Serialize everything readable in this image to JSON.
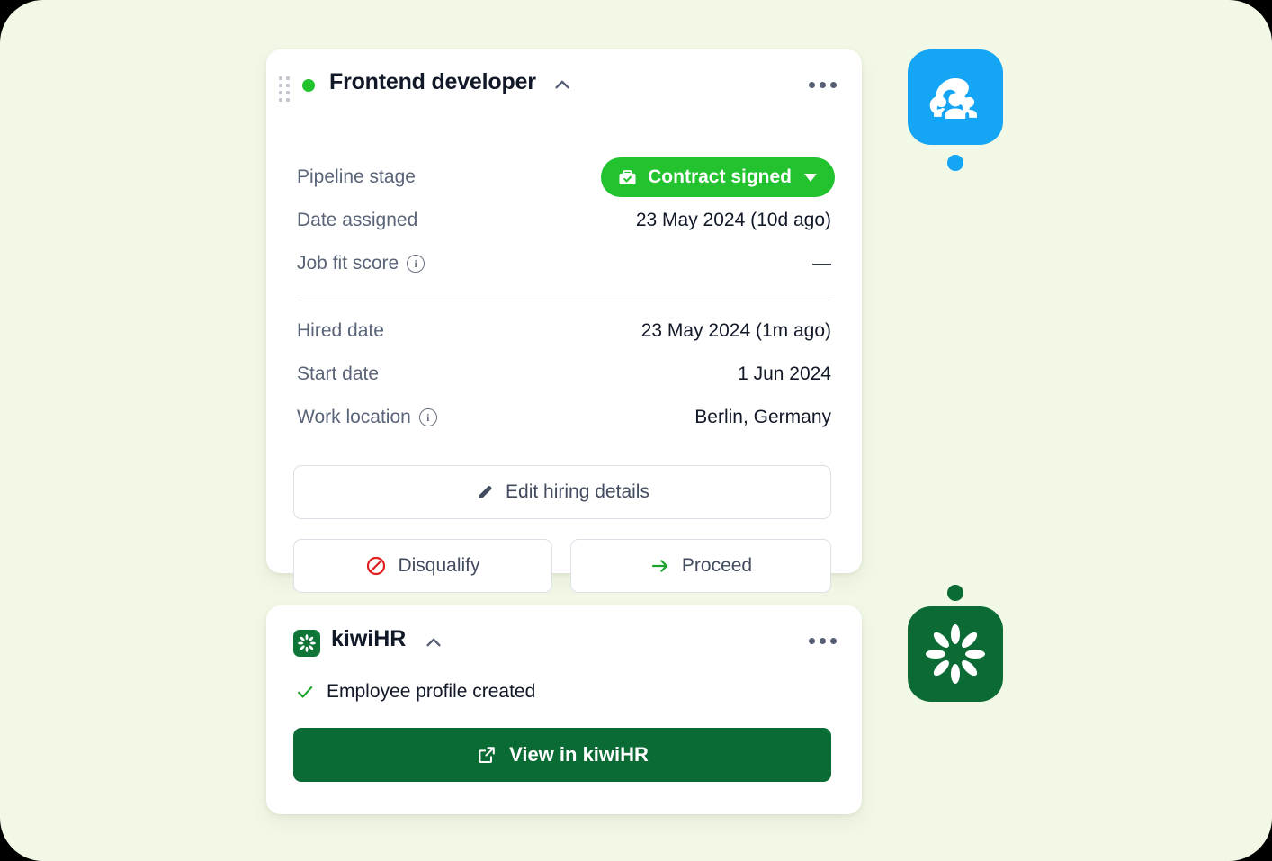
{
  "theme": {
    "page_bg": "#F2F8E6",
    "accent_green": "#22C32E",
    "kiwi_green": "#0B6B34",
    "recruitee_blue": "#14A5F5",
    "text_primary": "#111827",
    "text_muted": "#5A6478",
    "disqualify_red": "#E02020",
    "proceed_green": "#1BA32C"
  },
  "job_card": {
    "title": "Frontend developer",
    "status_dot": "active-green-dot",
    "drag_handle_icon": "drag-handle-icon",
    "collapse_icon": "chevron-up-icon",
    "menu_icon": "more-options-icon",
    "fields_top": [
      {
        "label": "Pipeline stage",
        "type": "badge",
        "value": "Contract signed",
        "badge_icon": "briefcase-check-icon",
        "badge_caret": "chevron-down-icon",
        "badge_color": "#22C32E"
      },
      {
        "label": "Date assigned",
        "type": "text",
        "value": "23 May 2024 (10d ago)"
      },
      {
        "label": "Job fit score",
        "type": "text",
        "value": "—",
        "info_icon": "info-icon",
        "info_glyph": "i"
      }
    ],
    "fields_bottom": [
      {
        "label": "Hired date",
        "type": "text",
        "value": "23 May 2024 (1m ago)"
      },
      {
        "label": "Start date",
        "type": "text",
        "value": "1 Jun 2024"
      },
      {
        "label": "Work location",
        "type": "text",
        "value": "Berlin, Germany",
        "info_icon": "info-icon",
        "info_glyph": "i"
      }
    ],
    "buttons": {
      "edit": {
        "label": "Edit hiring details",
        "icon": "pencil-icon"
      },
      "disqualify": {
        "label": "Disqualify",
        "icon": "no-entry-icon"
      },
      "proceed": {
        "label": "Proceed",
        "icon": "arrow-right-icon"
      }
    }
  },
  "kiwi_card": {
    "title": "kiwiHR",
    "logo_icon": "kiwihr-logo-icon",
    "collapse_icon": "chevron-up-icon",
    "menu_icon": "more-options-icon",
    "status": {
      "icon": "checkmark-icon",
      "text": "Employee profile created"
    },
    "primary_button": {
      "label": "View in kiwiHR",
      "icon": "external-link-icon"
    }
  },
  "integration_rail": {
    "top_app": {
      "icon": "recruitee-people-icon",
      "color": "#14A5F5"
    },
    "bottom_app": {
      "icon": "kiwihr-logo-icon",
      "color": "#0C6B34"
    },
    "connector": {
      "start_dot_color": "#14A5F5",
      "end_dot_color": "#0B6B34",
      "icon": "connector-line-icon"
    }
  }
}
